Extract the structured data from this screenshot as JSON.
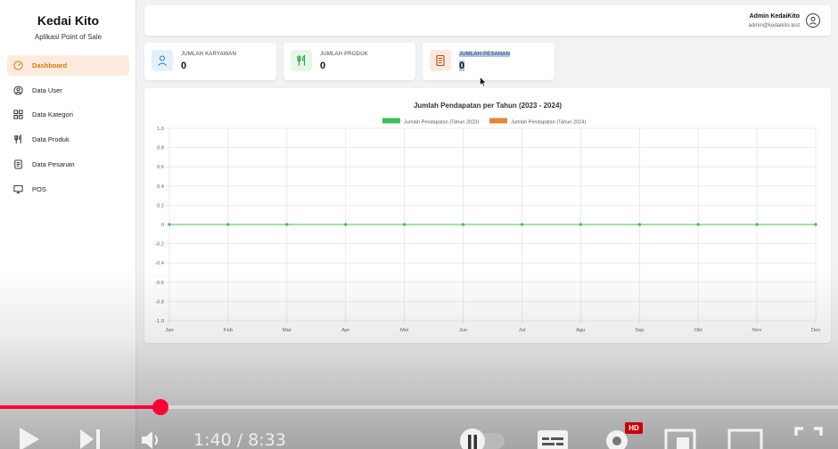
{
  "sidebar": {
    "brand_title": "Kedai Kito",
    "brand_subtitle": "Aplikasi Point of Sale",
    "items": [
      {
        "label": "Dashboard",
        "icon": "gauge-icon",
        "active": true
      },
      {
        "label": "Data User",
        "icon": "user-circle-icon"
      },
      {
        "label": "Data Kategori",
        "icon": "grid-icon"
      },
      {
        "label": "Data Produk",
        "icon": "utensils-icon"
      },
      {
        "label": "Data Pesanan",
        "icon": "receipt-icon"
      },
      {
        "label": "POS",
        "icon": "monitor-icon"
      }
    ]
  },
  "header": {
    "admin_name": "Admin KedaiKito",
    "admin_email": "admin@kedaikito.test"
  },
  "stats": [
    {
      "label": "JUMLAH KARYAWAN",
      "value": "0",
      "icon": "user-icon",
      "color": "#2b7fb8"
    },
    {
      "label": "JUMLAH PRODUK",
      "value": "0",
      "icon": "utensils-icon",
      "color": "#2f9e44"
    },
    {
      "label": "JUMLAH PESANAN",
      "value": "0",
      "icon": "receipt-icon",
      "color": "#c2410c"
    }
  ],
  "chart_data": {
    "type": "line",
    "title": "Jumlah Pendapatan per Tahun (2023 - 2024)",
    "categories": [
      "Jan",
      "Feb",
      "Mar",
      "Apr",
      "Mei",
      "Jun",
      "Jul",
      "Agu",
      "Sep",
      "Okt",
      "Nov",
      "Des"
    ],
    "series": [
      {
        "name": "Jumlah Pendapatan (Tahun 2023)",
        "color": "#40c057",
        "values": [
          0,
          0,
          0,
          0,
          0,
          0,
          0,
          0,
          0,
          0,
          0,
          0
        ]
      },
      {
        "name": "Jumlah Pendapatan (Tahun 2024)",
        "color": "#e8833a",
        "values": [
          0,
          0,
          0,
          0,
          0,
          0,
          0,
          0,
          0,
          0,
          0,
          0
        ]
      }
    ],
    "yticks": [
      "1.0",
      "0.8",
      "0.6",
      "0.4",
      "0.2",
      "0",
      "-0.2",
      "-0.4",
      "-0.6",
      "-0.8",
      "-1.0"
    ],
    "ylim": [
      -1,
      1
    ],
    "grid": true,
    "legend_position": "top"
  },
  "player": {
    "time": "1:40 / 8:33",
    "progress": 0.1915,
    "hd_label": "HD",
    "accent": "#ff0033"
  }
}
